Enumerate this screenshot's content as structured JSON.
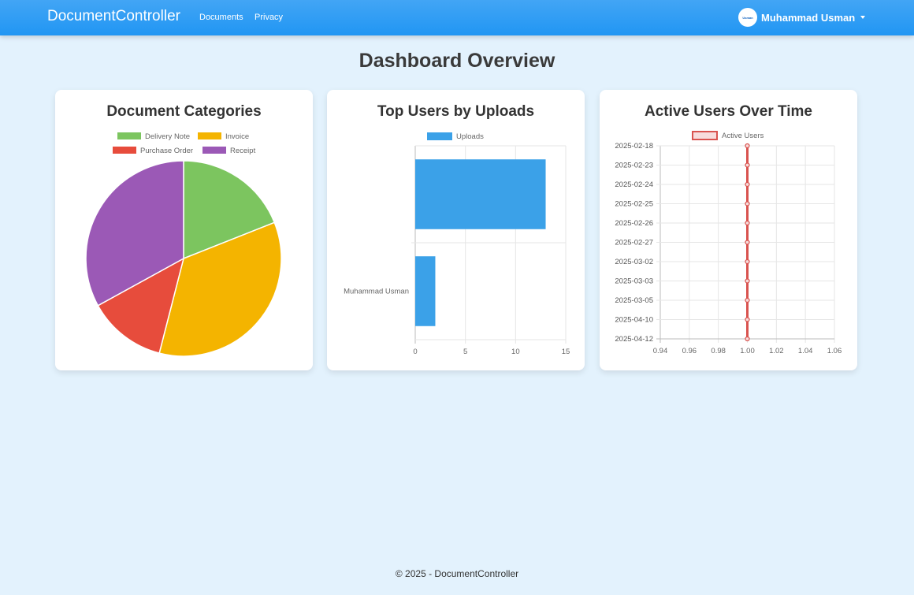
{
  "navbar": {
    "brand": "DocumentController",
    "links": [
      "Documents",
      "Privacy"
    ],
    "user": {
      "name": "Muhammad Usman",
      "avatar_text": "Usman"
    }
  },
  "page": {
    "title": "Dashboard Overview"
  },
  "colors": {
    "navbar": "#2196f3",
    "background": "#e3f2fd",
    "delivery_note": "#7cc55f",
    "invoice": "#f4b400",
    "purchase_order": "#e74c3c",
    "receipt": "#9b59b6",
    "uploads": "#3ba1e8",
    "active_users": "#d9534f"
  },
  "cards": [
    {
      "title": "Document Categories"
    },
    {
      "title": "Top Users by Uploads"
    },
    {
      "title": "Active Users Over Time"
    }
  ],
  "chart_data": [
    {
      "type": "pie",
      "title": "Document Categories",
      "labels": [
        "Delivery Note",
        "Invoice",
        "Purchase Order",
        "Receipt"
      ],
      "values": [
        19,
        35,
        13,
        33
      ],
      "legend": "top"
    },
    {
      "type": "bar",
      "orientation": "horizontal",
      "title": "Top Users by Uploads",
      "categories": [
        "",
        "Muhammad Usman"
      ],
      "series": [
        {
          "name": "Uploads",
          "values": [
            13,
            2
          ]
        }
      ],
      "xlim": [
        0,
        15
      ],
      "xticks": [
        0,
        5,
        10,
        15
      ],
      "legend": "top",
      "grid": true
    },
    {
      "type": "line",
      "title": "Active Users Over Time",
      "categories": [
        "2025-02-18",
        "2025-02-23",
        "2025-02-24",
        "2025-02-25",
        "2025-02-26",
        "2025-02-27",
        "2025-03-02",
        "2025-03-03",
        "2025-03-05",
        "2025-04-10",
        "2025-04-12"
      ],
      "series": [
        {
          "name": "Active Users",
          "values": [
            1,
            1,
            1,
            1,
            1,
            1,
            1,
            1,
            1,
            1,
            1
          ]
        }
      ],
      "xlim": [
        0.94,
        1.06
      ],
      "xticks": [
        "0.94",
        "0.96",
        "0.98",
        "1.00",
        "1.02",
        "1.04",
        "1.06"
      ],
      "legend": "top",
      "grid": true
    }
  ],
  "footer": {
    "text": "© 2025 - DocumentController"
  }
}
